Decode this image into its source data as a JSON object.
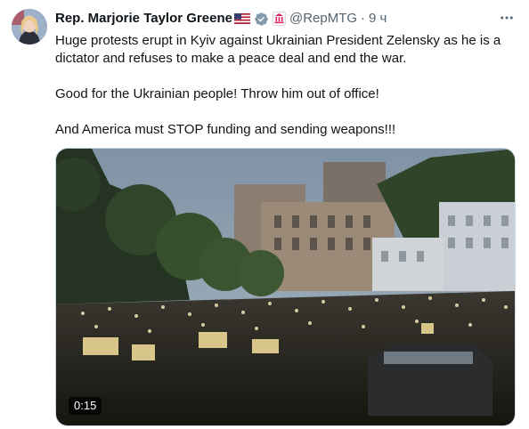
{
  "author": {
    "name": "Rep. Marjorie Taylor Greene",
    "flag_icon": "us-flag-icon",
    "verified_icon": "verified-badge-icon",
    "affiliation_icon": "government-affiliation-icon",
    "handle": "@RepMTG",
    "separator": "·",
    "time": "9 ч"
  },
  "tweet": {
    "paragraphs": [
      "Huge protests erupt in Kyiv against Ukrainian President Zelensky as he is a dictator and refuses to make a peace deal and end the war.",
      "Good for the Ukrainian people! Throw him out of office!",
      "And America must STOP funding and sending weapons!!!"
    ]
  },
  "media": {
    "type": "video",
    "duration": "0:15"
  },
  "colors": {
    "text": "#0f1419",
    "secondary": "#536471",
    "verified": "#829aab",
    "affiliation": "#e0245e"
  }
}
